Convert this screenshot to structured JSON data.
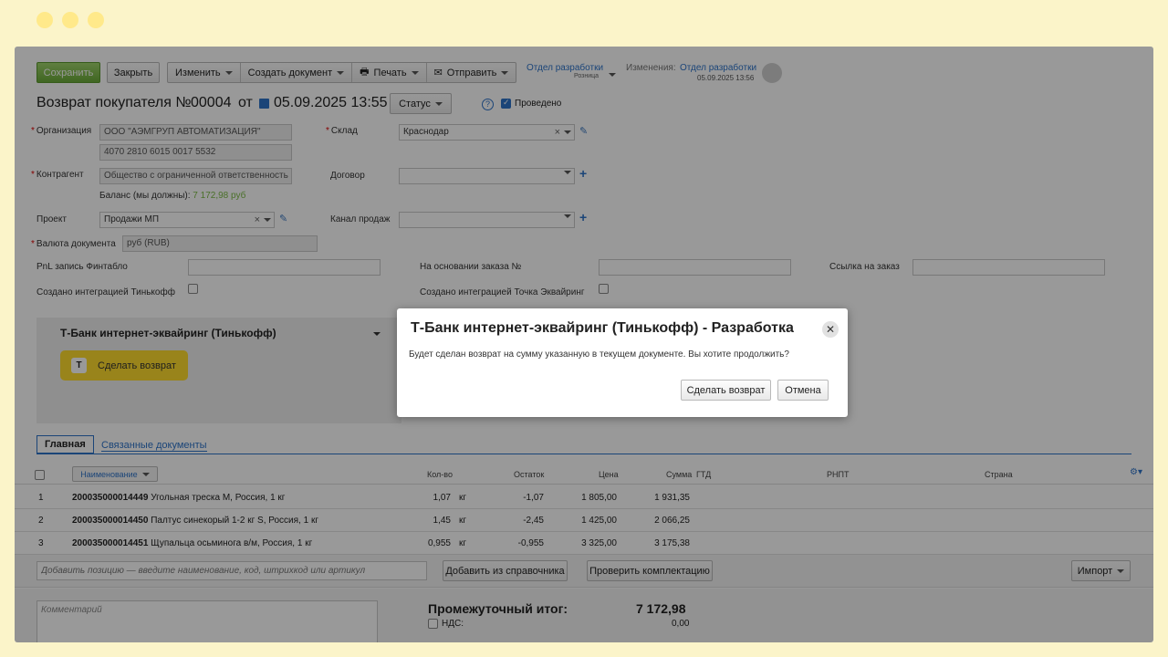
{
  "window_dots": [
    "dot1",
    "dot2",
    "dot3"
  ],
  "toolbar": {
    "save": "Сохранить",
    "close": "Закрыть",
    "change": "Изменить",
    "create_doc": "Создать документ",
    "print": "Печать",
    "send": "Отправить"
  },
  "header_info": {
    "department": "Отдел разработки",
    "department_sub": "Розница",
    "changes_label": "Изменения:",
    "changes_by": "Отдел разработки",
    "changes_date": "05.09.2025 13:56"
  },
  "doc": {
    "title": "Возврат покупателя №",
    "number": "00004",
    "from": "от",
    "datetime": "05.09.2025 13:55",
    "status_label": "Статус",
    "help": "?",
    "posted_label": "Проведено"
  },
  "form": {
    "org_label": "Организация",
    "org_value": "ООО \"АЭМГРУП АВТОМАТИЗАЦИЯ\"",
    "account_value": "4070 2810 6015 0017 5532",
    "warehouse_label": "Склад",
    "warehouse_value": "Краснодар",
    "counterparty_label": "Контрагент",
    "counterparty_value": "Общество с ограниченной ответственность",
    "contract_label": "Договор",
    "balance_label": "Баланс (мы должны):",
    "balance_value": "7 172,98 руб",
    "project_label": "Проект",
    "project_value": "Продажи МП",
    "channel_label": "Канал продаж",
    "currency_label": "Валюта документа",
    "currency_value": "руб (RUB)",
    "pnl_label": "PnL запись Финтабло",
    "order_basis_label": "На основании заказа №",
    "order_link_label": "Ссылка на заказ",
    "tinkoff_created_label": "Создано интеграцией Тинькофф",
    "tochka_created_label": "Создано интеграцией Точка Эквайринг"
  },
  "widget": {
    "title": "Т-Банк интернет-эквайринг (Тинькофф)",
    "logo": "T",
    "refund_button": "Сделать возврат"
  },
  "tabs": [
    "Главная",
    "Связанные документы"
  ],
  "table": {
    "headers": {
      "name": "Наименование",
      "qty": "Кол-во",
      "stock": "Остаток",
      "price": "Цена",
      "sum": "Сумма",
      "gtd": "ГТД",
      "rnpt": "РНПТ",
      "country": "Страна"
    },
    "rows": [
      {
        "n": "1",
        "code": "200035000014449",
        "name": "Угольная треска М, Россия, 1 кг",
        "qty": "1,07",
        "unit": "кг",
        "stock": "-1,07",
        "price": "1 805,00",
        "sum": "1 931,35"
      },
      {
        "n": "2",
        "code": "200035000014450",
        "name": "Палтус синекорый 1-2 кг S, Россия, 1 кг",
        "qty": "1,45",
        "unit": "кг",
        "stock": "-2,45",
        "price": "1 425,00",
        "sum": "2 066,25"
      },
      {
        "n": "3",
        "code": "200035000014451",
        "name": "Щупальца осьминога в/м, Россия, 1 кг",
        "qty": "0,955",
        "unit": "кг",
        "stock": "-0,955",
        "price": "3 325,00",
        "sum": "3 175,38"
      }
    ]
  },
  "add_row": {
    "placeholder": "Добавить позицию — введите наименование, код, штрихкод или артикул",
    "from_catalog": "Добавить из справочника",
    "check_kit": "Проверить комплектацию",
    "import": "Импорт"
  },
  "footer": {
    "comment_placeholder": "Комментарий",
    "subtotal_label": "Промежуточный итог:",
    "subtotal_value": "7 172,98",
    "vat_label": "НДС:",
    "vat_value": "0,00"
  },
  "modal": {
    "title": "Т-Банк интернет-эквайринг (Тинькофф) - Разработка",
    "text": "Будет сделан возврат на сумму указанную в текущем документе. Вы хотите продолжить?",
    "confirm": "Сделать возврат",
    "cancel": "Отмена"
  },
  "colors": {
    "accent": "#2e73c9",
    "save_green": "#7cbb45",
    "widget_yellow": "#ffdd2d",
    "frame_bg": "#fbf4c9"
  }
}
